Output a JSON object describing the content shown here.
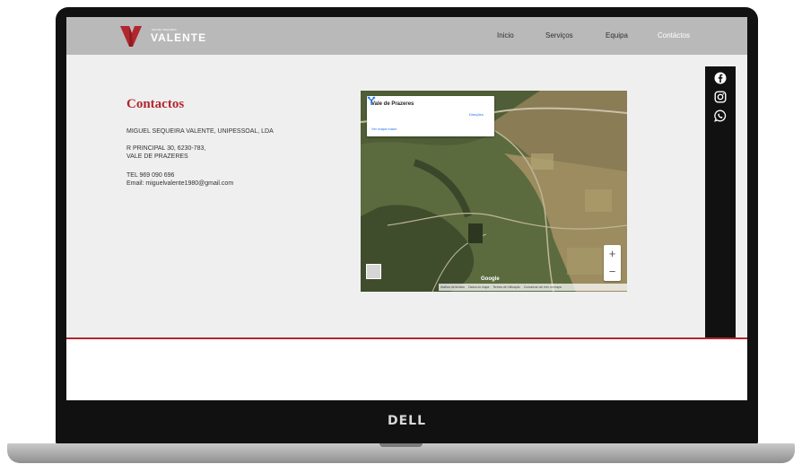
{
  "header": {
    "logo_small": "MIGUEL SEQUEIRA",
    "logo_text": "VALENTE",
    "nav": [
      {
        "label": "Inicio",
        "active": false
      },
      {
        "label": "Serviços",
        "active": false
      },
      {
        "label": "Equipa",
        "active": false
      },
      {
        "label": "Contáctos",
        "active": true
      }
    ]
  },
  "contacts": {
    "title": "Contactos",
    "company": "MIGUEL SEQUEIRA VALENTE, UNIPESSOAL, LDA",
    "address_line1": "R PRINCIPAL 30, 6230-783,",
    "address_line2": "VALE DE PRAZERES",
    "phone": "TEL 969 090 696",
    "email": "Email: miguelvalente1980@gmail.com"
  },
  "map": {
    "place_title": "Vale de Prazeres",
    "directions_label": "Direções",
    "larger_map_link": "Ver mapa maior",
    "zoom_in": "+",
    "zoom_out": "−",
    "provider": "Google",
    "attribution": [
      "Atalhos de teclado",
      "Dados do mapa",
      "Termos de Utilização",
      "Comunicar um erro no mapa"
    ]
  },
  "social": [
    "facebook-icon",
    "instagram-icon",
    "whatsapp-icon"
  ],
  "device": {
    "brand": "DELL"
  },
  "colors": {
    "accent": "#b3262e",
    "header": "#b9b9b9",
    "sidebar": "#111111",
    "page": "#efefef"
  }
}
